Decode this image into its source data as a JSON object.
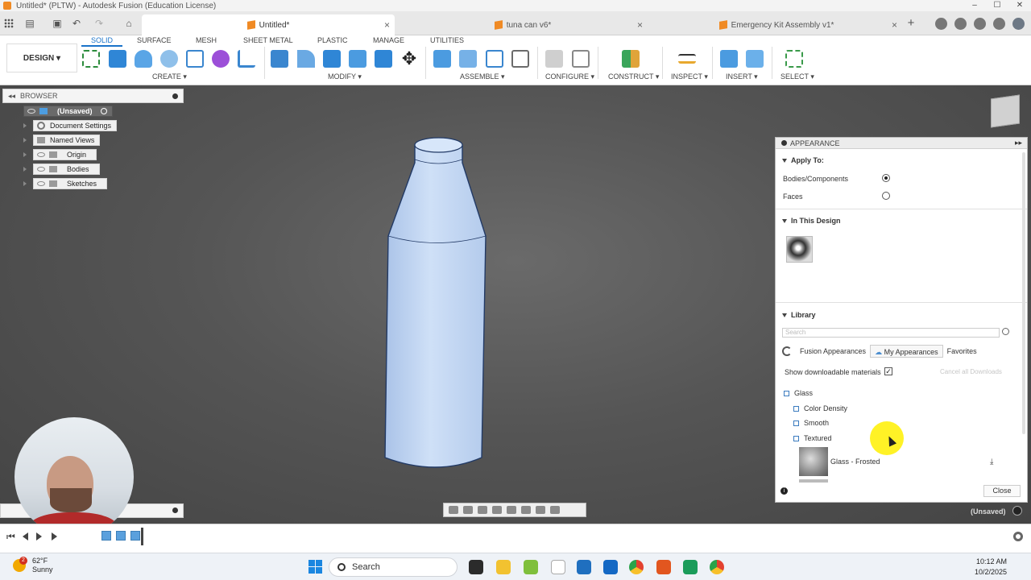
{
  "window": {
    "title": "Untitled* (PLTW) - Autodesk Fusion (Education License)"
  },
  "tabs": [
    {
      "label": "Untitled*"
    },
    {
      "label": "tuna can v6*"
    },
    {
      "label": "Emergency Kit Assembly v1*"
    }
  ],
  "toolbar": {
    "design_label": "DESIGN ▾",
    "workspace_tabs": [
      "SOLID",
      "SURFACE",
      "MESH",
      "SHEET METAL",
      "PLASTIC",
      "MANAGE",
      "UTILITIES"
    ],
    "groups": [
      "CREATE ▾",
      "MODIFY ▾",
      "ASSEMBLE ▾",
      "CONFIGURE ▾",
      "CONSTRUCT ▾",
      "INSPECT ▾",
      "INSERT ▾",
      "SELECT ▾"
    ]
  },
  "browser": {
    "title": "BROWSER",
    "items": [
      {
        "label": "(Unsaved)"
      },
      {
        "label": "Document Settings"
      },
      {
        "label": "Named Views"
      },
      {
        "label": "Origin"
      },
      {
        "label": "Bodies"
      },
      {
        "label": "Sketches"
      }
    ]
  },
  "appearance": {
    "title": "APPEARANCE",
    "apply_to": "Apply To:",
    "bodies_components": "Bodies/Components",
    "faces": "Faces",
    "in_this_design": "In This Design",
    "library": "Library",
    "search_placeholder": "Search",
    "lib_tabs": [
      "Fusion Appearances",
      "My Appearances",
      "Favorites"
    ],
    "show_downloadable": "Show downloadable materials",
    "cancel_downloads": "Cancel all Downloads",
    "tree": [
      "Glass",
      "Color Density",
      "Smooth",
      "Textured"
    ],
    "material": "Glass - Frosted",
    "close": "Close"
  },
  "status": {
    "unsaved": "(Unsaved)"
  },
  "taskbar": {
    "temp": "62°F",
    "weather": "Sunny",
    "weather_badge": "2",
    "search": "Search",
    "time": "10:12 AM",
    "date": "10/2/2025"
  },
  "colors": {
    "accent": "#1a73c9",
    "bottle": "#c6d8f2",
    "highlight": "#fff000"
  }
}
